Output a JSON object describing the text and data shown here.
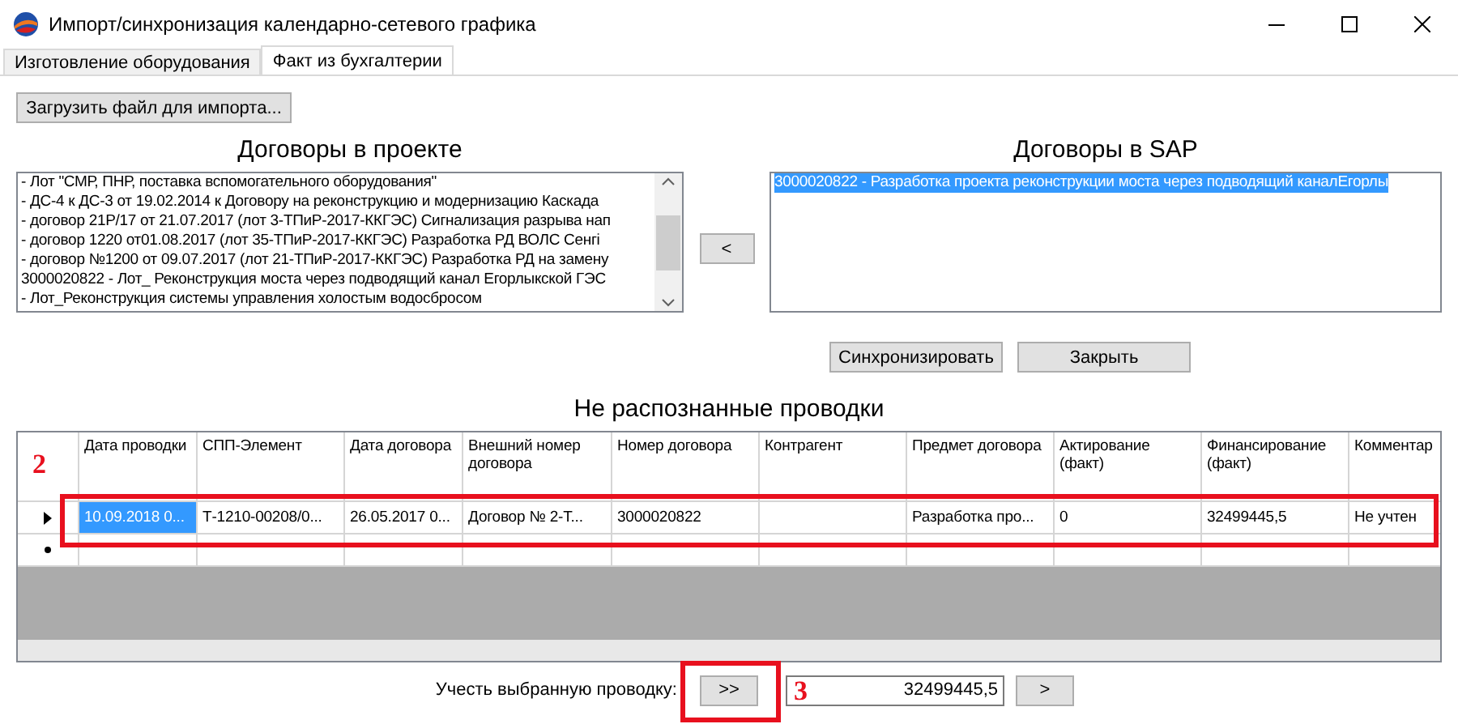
{
  "window": {
    "title": "Импорт/синхронизация календарно-сетевого графика"
  },
  "tabs": [
    {
      "label": "Изготовление оборудования",
      "selected": false
    },
    {
      "label": "Факт из бухгалтерии",
      "selected": true
    }
  ],
  "load_button": "Загрузить файл для импорта...",
  "project_contracts": {
    "heading": "Договоры в проекте",
    "items": [
      {
        "text": "- Лот \"СМР, ПНР, поставка вспомогательного оборудования\"",
        "selected": false
      },
      {
        "text": "- ДС-4 к ДС-3 от 19.02.2014 к  Договору на реконструкцию и модернизацию Каскада",
        "selected": false
      },
      {
        "text": "- договор 21Р/17 от 21.07.2017 (лот 3-ТПиР-2017-ККГЭС) Сигнализация разрыва нап",
        "selected": false
      },
      {
        "text": "- договор 1220  от01.08.2017 (лот 35-ТПиР-2017-ККГЭС)  Разработка РД ВОЛС Сенгі",
        "selected": false
      },
      {
        "text": "- договор №1200 от 09.07.2017 (лот 21-ТПиР-2017-ККГЭС)  Разработка РД на замену",
        "selected": false
      },
      {
        "text": "3000020822 - Лот_ Реконструкция моста через подводящий канал Егорлыкской ГЭС",
        "selected": false
      },
      {
        "text": "- Лот_Реконструкция системы управления холостым водосбросом",
        "selected": false
      }
    ]
  },
  "move_left_button": "<",
  "sap_contracts": {
    "heading": "Договоры в SAP",
    "items": [
      {
        "text": "3000020822 - Разработка проекта реконструкции моста через подводящий каналЕгорлы",
        "selected": true
      }
    ]
  },
  "sync_button": "Синхронизировать",
  "close_button": "Закрыть",
  "unrecognized": {
    "heading": "Не распознанные проводки",
    "columns": [
      "Дата проводки",
      "СПП-Элемент",
      "Дата договора",
      "Внешний номер договора",
      "Номер договора",
      "Контрагент",
      "Предмет договора",
      "Актирование (факт)",
      "Финансирование (факт)",
      "Комментар"
    ],
    "rows": [
      {
        "current": true,
        "cells": [
          {
            "text": "10.09.2018 0...",
            "selected": true
          },
          {
            "text": "Т-1210-00208/0...",
            "selected": false
          },
          {
            "text": "26.05.2017 0...",
            "selected": false
          },
          {
            "text": "Договор № 2-Т...",
            "selected": false
          },
          {
            "text": "3000020822",
            "selected": false
          },
          {
            "selected": false
          },
          {
            "text": "Разработка про...",
            "selected": false
          },
          {
            "text": "0",
            "selected": false
          },
          {
            "text": "32499445,5",
            "selected": false
          },
          {
            "text": "Не учтен",
            "selected": false
          }
        ]
      }
    ],
    "new_row": true
  },
  "bottom": {
    "label": "Учесть выбранную проводку:",
    "apply_button": ">>",
    "amount": "32499445,5",
    "next_button": ">"
  },
  "annotations": [
    {
      "label": "2"
    },
    {
      "label": "3"
    }
  ]
}
